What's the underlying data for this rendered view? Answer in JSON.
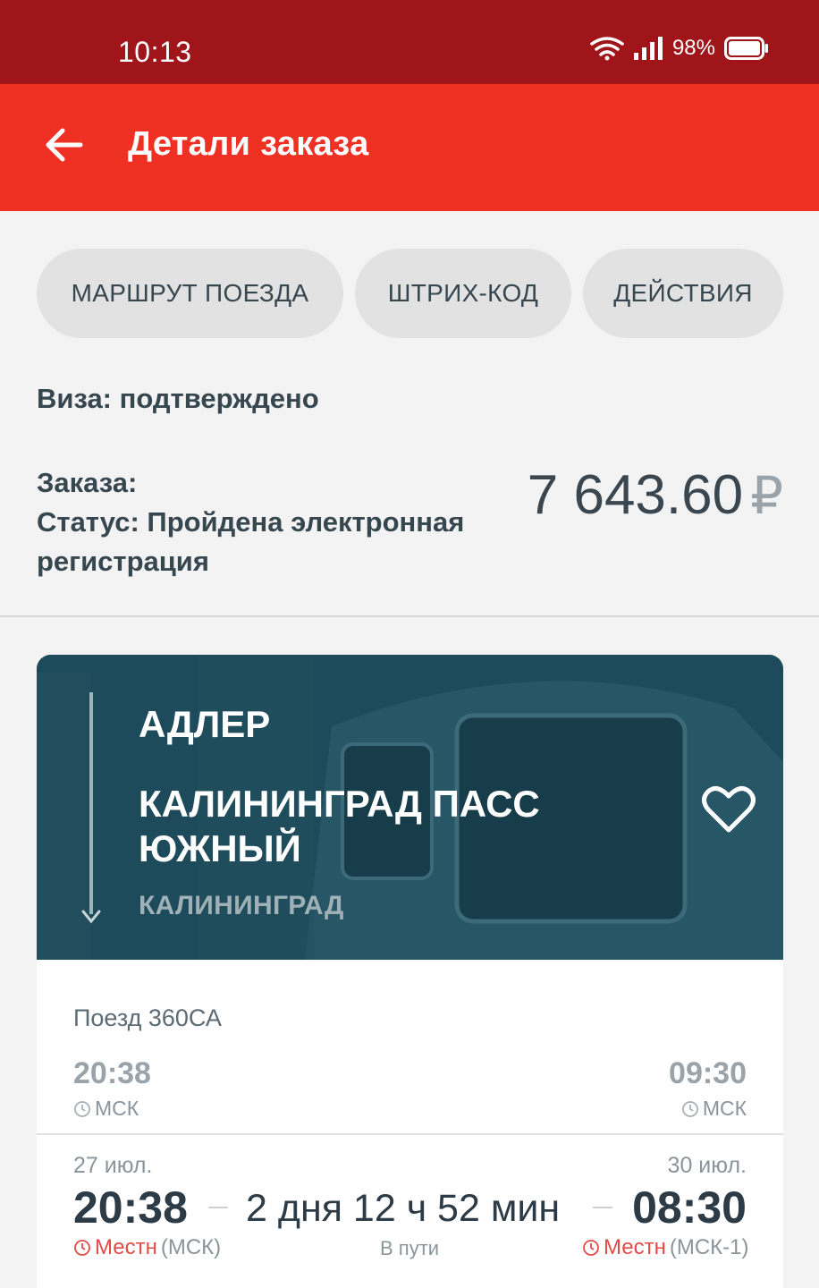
{
  "status_bar": {
    "time": "10:13",
    "battery": "98%"
  },
  "app_bar": {
    "title": "Детали заказа"
  },
  "chips": [
    {
      "label": "МАРШРУТ ПОЕЗДА"
    },
    {
      "label": "ШТРИХ-КОД"
    },
    {
      "label": "ДЕЙСТВИЯ"
    }
  ],
  "order": {
    "visa": "Виза: подтверждено",
    "number_label": "Заказа:",
    "status": "Статус: Пройдена электронная регистрация",
    "price": "7 643.60",
    "currency": "₽"
  },
  "route": {
    "from": "АДЛЕР",
    "to": "КАЛИНИНГРАД ПАСС ЮЖНЫЙ",
    "to_region": "КАЛИНИНГРАД"
  },
  "train": {
    "number": "Поезд 360СА",
    "msk_departure": "20:38",
    "msk_arrival": "09:30",
    "msk_zone": "МСК",
    "departure_date": "27 июл.",
    "arrival_date": "30 июл.",
    "local_departure": "20:38",
    "local_arrival": "08:30",
    "duration": "2 дня 12 ч 52 мин",
    "duration_label": "В пути",
    "local_label": "Местн",
    "departure_zone": "(МСК)",
    "arrival_zone": "(МСК-1)"
  },
  "colors": {
    "status_bar": "#a0151a",
    "app_bar": "#ef3124",
    "card_bg": "#1f4c5c",
    "accent_red": "#e44a48"
  }
}
